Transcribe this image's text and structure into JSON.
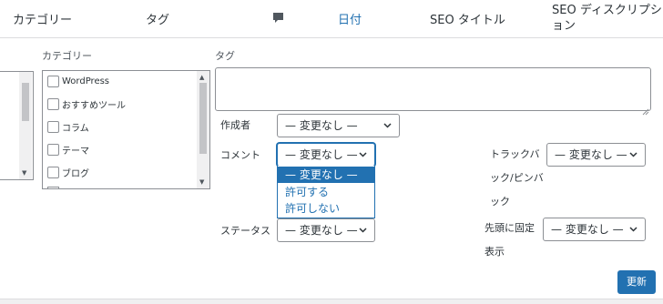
{
  "header": {
    "col_category": "カテゴリー",
    "col_tags": "タグ",
    "col_comments_icon": "comment-bubble-icon",
    "col_date": "日付",
    "col_seo_title": "SEO タイトル",
    "col_seo_description": "SEO ディスクリプション"
  },
  "bulk_edit": {
    "categories": {
      "label": "カテゴリー",
      "items": [
        {
          "label": "WordPress",
          "checked": false
        },
        {
          "label": "おすすめツール",
          "checked": false
        },
        {
          "label": "コラム",
          "checked": false
        },
        {
          "label": "テーマ",
          "checked": false
        },
        {
          "label": "ブログ",
          "checked": false
        }
      ]
    },
    "tags": {
      "label": "タグ",
      "value": ""
    },
    "author": {
      "label": "作成者",
      "value": "— 変更なし —"
    },
    "comments": {
      "label": "コメント",
      "value": "— 変更なし —",
      "expanded": true,
      "options": [
        "— 変更なし —",
        "許可する",
        "許可しない"
      ],
      "selected_index": 0
    },
    "pings": {
      "label": "トラックバック/ピンバック",
      "value": "— 変更なし —"
    },
    "status": {
      "label": "ステータス",
      "value": "— 変更なし —"
    },
    "sticky": {
      "label": "先頭に固定表示",
      "value": "— 変更なし —"
    },
    "update_button": "更新"
  },
  "colors": {
    "accent": "#2271b1",
    "border": "#8c8f94",
    "text": "#2c3338"
  }
}
